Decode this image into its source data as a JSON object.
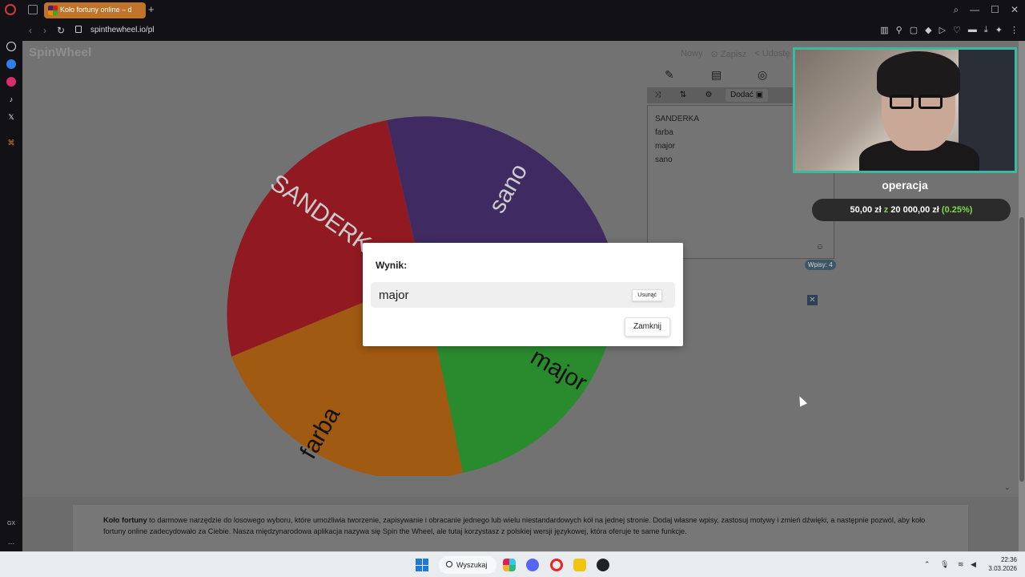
{
  "browser": {
    "tab_title": "Koło fortuny online – d",
    "url": "spinthewheel.io/pl"
  },
  "site": {
    "logo": "SpinWheel",
    "top_actions": [
      "Nowy",
      "Zapisz",
      "Udostę"
    ],
    "add_button": "Dodać",
    "entries_count": "Wpisy: 4",
    "entries": [
      "SANDERKA",
      "farba",
      "major",
      "sano"
    ]
  },
  "wheel": {
    "segments": [
      {
        "label": "SANDERKA",
        "color": "#911a22"
      },
      {
        "label": "sano",
        "color": "#3f2a62"
      },
      {
        "label": "major",
        "color": "#2a8a2e"
      },
      {
        "label": "farba",
        "color": "#a05a12"
      }
    ]
  },
  "modal": {
    "title": "Wynik:",
    "result": "major",
    "remove_label": "Usunąć",
    "close_label": "Zamknij"
  },
  "overlay": {
    "title": "operacja",
    "amount": "50,00 zł",
    "sep": "z",
    "goal": "20 000,00 zł",
    "percent": "(0.25%)"
  },
  "info": {
    "bold": "Koło fortuny",
    "text": " to darmowe narzędzie do losowego wyboru, które umożliwia tworzenie, zapisywanie i obracanie jednego lub wielu niestandardowych kół na jednej stronie. Dodaj własne wpisy, zastosuj motywy i zmień dźwięki, a następnie pozwól, aby koło fortuny online zadecydowało za Ciebie. Nasza międzynarodowa aplikacja nazywa się Spin the Wheel, ale tutaj korzystasz z polskiej wersji językowej, która oferuje te same funkcje."
  },
  "taskbar": {
    "search": "Wyszukaj",
    "time": "22:36",
    "date": "3.03.2026"
  }
}
